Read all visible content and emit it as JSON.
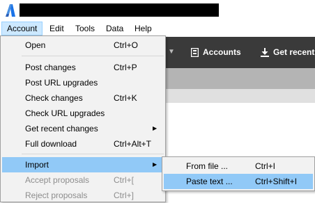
{
  "menubar": {
    "items": [
      "Account",
      "Edit",
      "Tools",
      "Data",
      "Help"
    ]
  },
  "toolbar": {
    "accounts_label": "Accounts",
    "get_recent_label": "Get recent"
  },
  "account_menu": {
    "items": [
      {
        "label": "Open",
        "shortcut": "Ctrl+O"
      },
      {
        "label": "Post changes",
        "shortcut": "Ctrl+P"
      },
      {
        "label": "Post URL upgrades",
        "shortcut": ""
      },
      {
        "label": "Check changes",
        "shortcut": "Ctrl+K"
      },
      {
        "label": "Check URL upgrades",
        "shortcut": ""
      },
      {
        "label": "Get recent changes",
        "shortcut": ""
      },
      {
        "label": "Full download",
        "shortcut": "Ctrl+Alt+T"
      },
      {
        "label": "Import",
        "shortcut": ""
      },
      {
        "label": "Accept proposals",
        "shortcut": "Ctrl+["
      },
      {
        "label": "Reject proposals",
        "shortcut": "Ctrl+]"
      }
    ]
  },
  "import_submenu": {
    "items": [
      {
        "label": "From file ...",
        "shortcut": "Ctrl+I"
      },
      {
        "label": "Paste text ...",
        "shortcut": "Ctrl+Shift+I"
      }
    ]
  },
  "colors": {
    "highlight": "#91c9f7",
    "menu_bg": "#f2f2f2",
    "toolbar_bg": "#3a3a3a",
    "logo_blue": "#1a73e8"
  },
  "icons": {
    "logo": "app-logo-icon",
    "accounts": "accounts-icon",
    "download": "download-icon",
    "submenu_arrow": "chevron-right-icon"
  }
}
